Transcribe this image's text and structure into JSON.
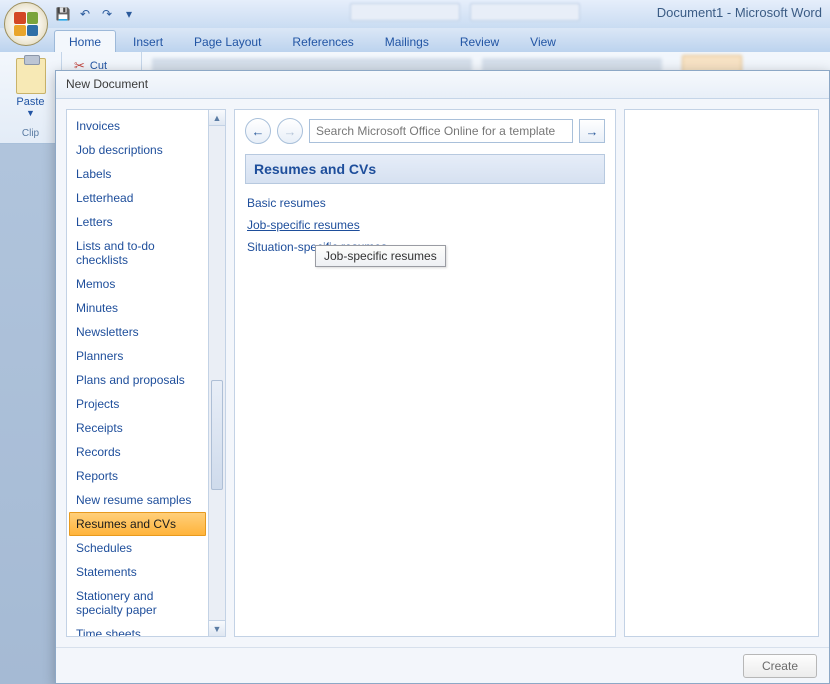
{
  "title": "Document1 - Microsoft Word",
  "ribbon": {
    "tabs": [
      "Home",
      "Insert",
      "Page Layout",
      "References",
      "Mailings",
      "Review",
      "View"
    ],
    "active_tab": 0,
    "cut_label": "Cut",
    "paste_label": "Paste",
    "clipboard_label": "Clip"
  },
  "dialog": {
    "title": "New Document",
    "categories": [
      "Invoices",
      "Job descriptions",
      "Labels",
      "Letterhead",
      "Letters",
      "Lists and to-do checklists",
      "Memos",
      "Minutes",
      "Newsletters",
      "Planners",
      "Plans and proposals",
      "Projects",
      "Receipts",
      "Records",
      "Reports",
      "New resume samples",
      "Resumes and CVs",
      "Schedules",
      "Statements",
      "Stationery and specialty paper",
      "Time sheets"
    ],
    "selected_index": 16,
    "search_placeholder": "Search Microsoft Office Online for a template",
    "header": "Resumes and CVs",
    "links": [
      "Basic resumes",
      "Job-specific resumes",
      "Situation-specific resumes"
    ],
    "hovered_link_index": 1,
    "tooltip": "Job-specific resumes",
    "create_label": "Create"
  }
}
